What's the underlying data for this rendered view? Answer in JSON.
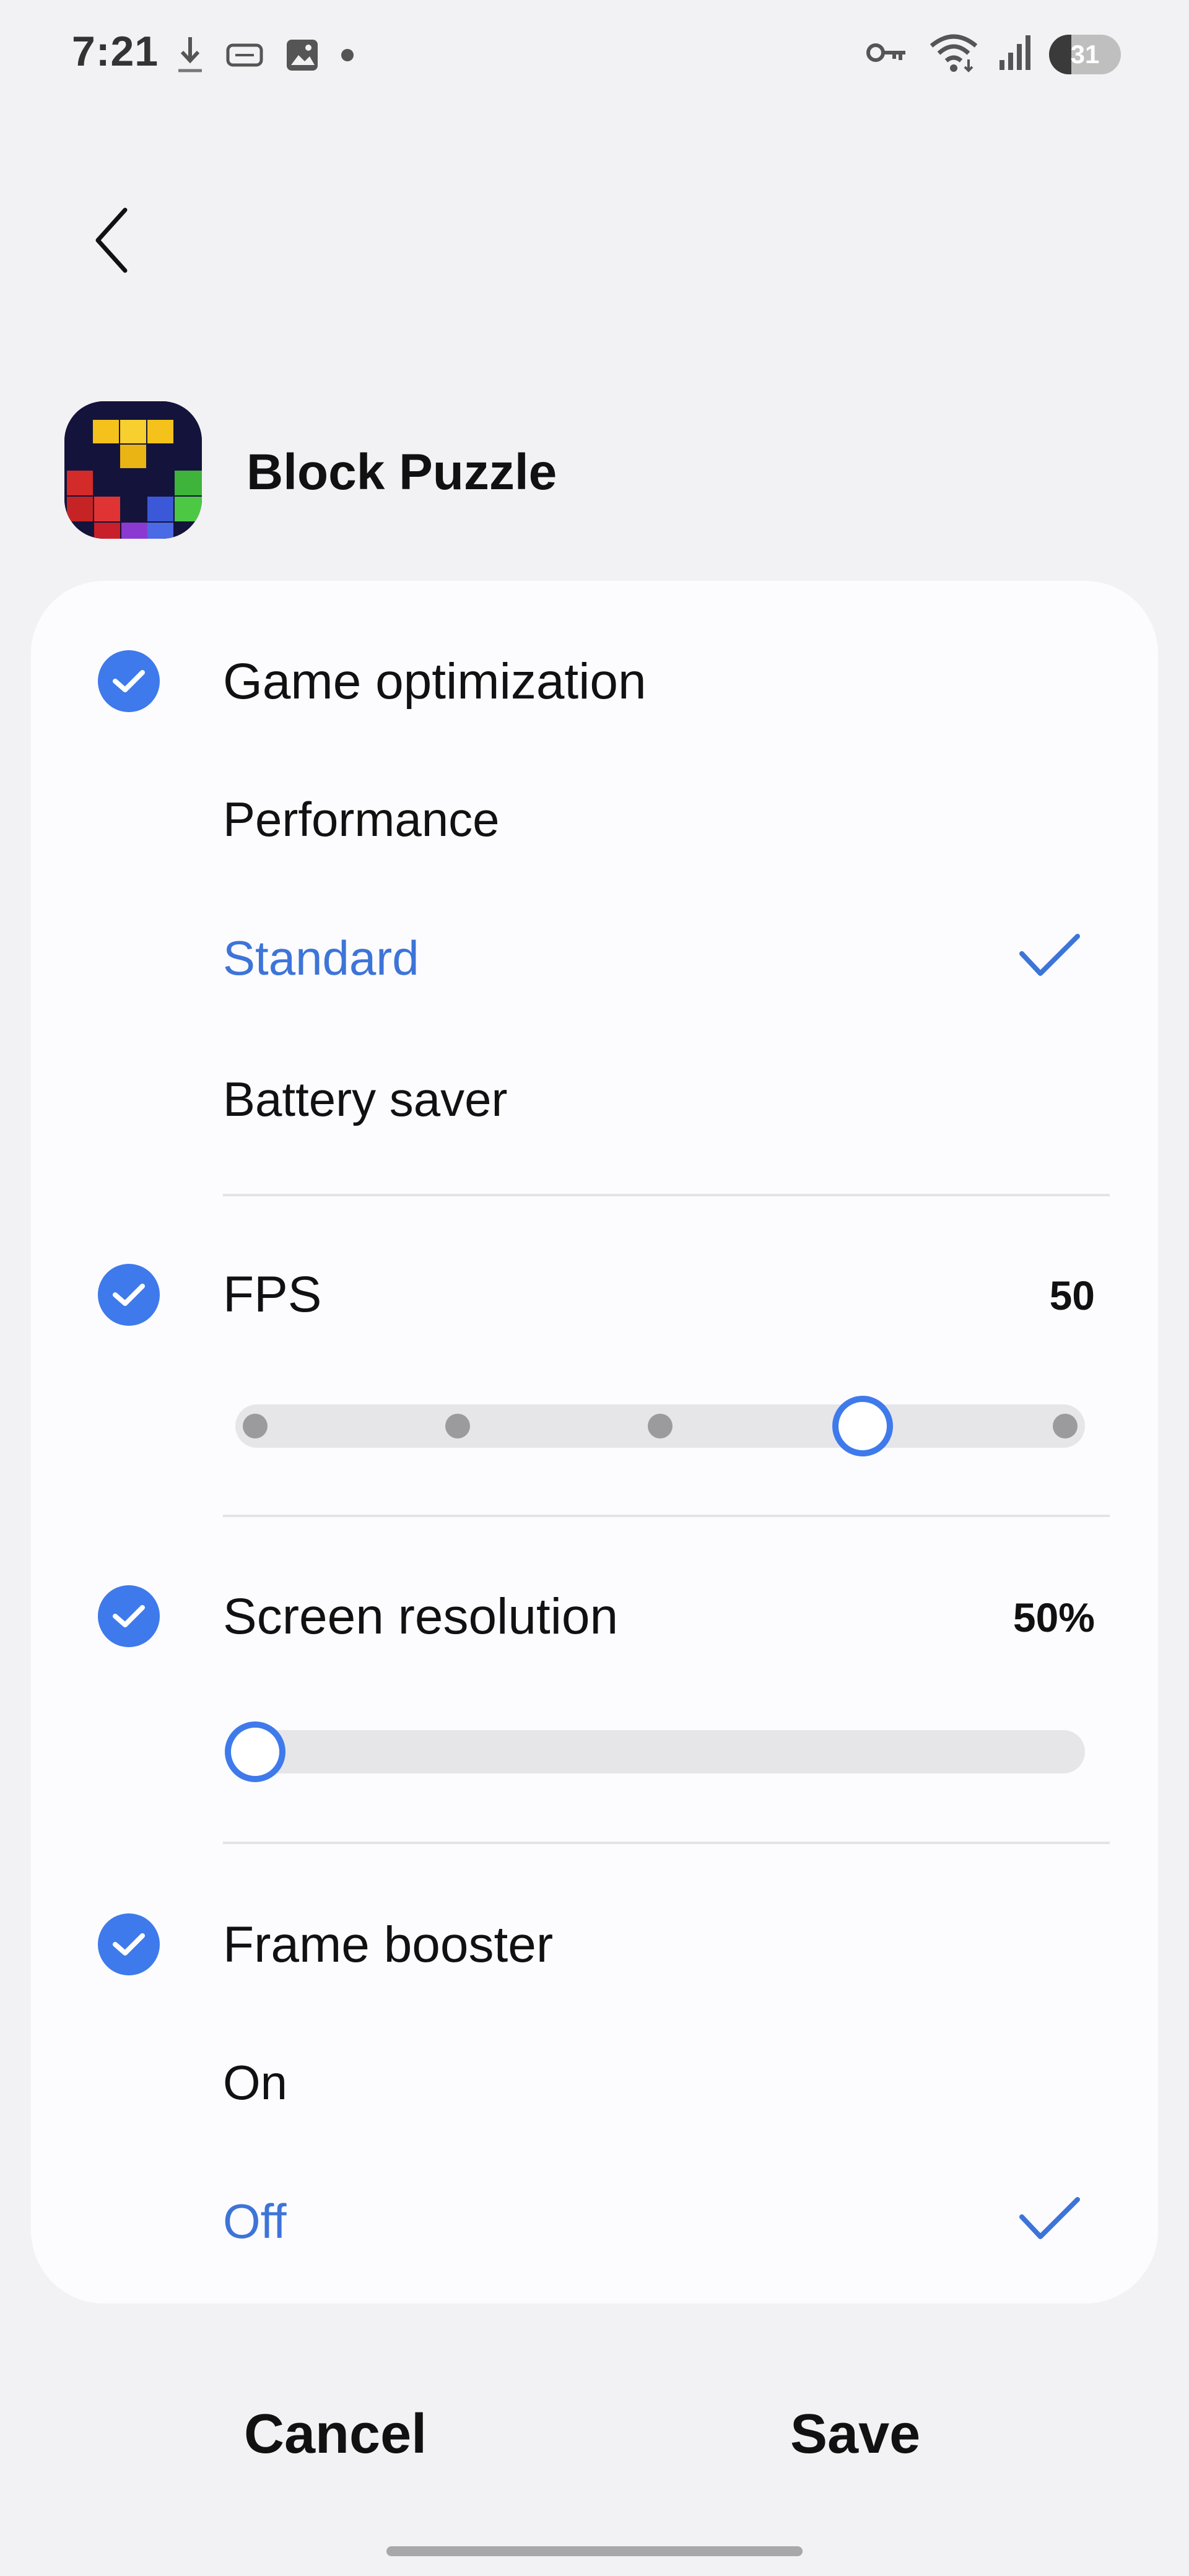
{
  "status_bar": {
    "time": "7:21",
    "left_icons": [
      "download-icon",
      "cast-icon",
      "gallery-icon",
      "dot-icon"
    ],
    "right_icons": [
      "vpn-key-icon",
      "wifi-icon",
      "signal-icon"
    ],
    "battery_level": "31"
  },
  "header": {
    "app_name": "Block Puzzle",
    "app_icon": "block-puzzle-app-icon"
  },
  "game_optimization": {
    "label": "Game optimization",
    "enabled": true,
    "options": [
      {
        "label": "Performance",
        "selected": false
      },
      {
        "label": "Standard",
        "selected": true
      },
      {
        "label": "Battery saver",
        "selected": false
      }
    ]
  },
  "fps": {
    "label": "FPS",
    "enabled": true,
    "value": "50",
    "steps": 5,
    "selected_index": 3
  },
  "screen_resolution": {
    "label": "Screen resolution",
    "enabled": true,
    "value": "50%",
    "slider_position": 0.0
  },
  "frame_booster": {
    "label": "Frame booster",
    "enabled": true,
    "options": [
      {
        "label": "On",
        "selected": false
      },
      {
        "label": "Off",
        "selected": true
      }
    ]
  },
  "actions": {
    "cancel_label": "Cancel",
    "save_label": "Save"
  },
  "colors": {
    "accent": "#3e7aeb",
    "selected_text": "#3d74d8",
    "background": "#f2f2f4",
    "card": "#fcfcfe"
  }
}
